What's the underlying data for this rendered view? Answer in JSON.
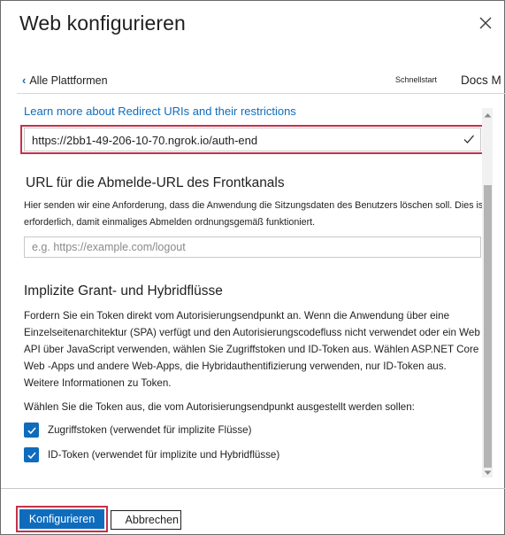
{
  "header": {
    "title": "Web konfigurieren",
    "close_icon": "close-icon"
  },
  "nav": {
    "back_label": "Alle Plattformen",
    "quickstart_label": "Schnellstart",
    "docs_label": "Docs M"
  },
  "redirect": {
    "learn_more": "Learn more about Redirect URIs and their restrictions",
    "url_value": "https://2bb1-49-206-10-70.ngrok.io/auth-end"
  },
  "logout": {
    "title": "URL für die Abmelde-URL des Frontkanals",
    "description": "Hier senden wir eine Anforderung, dass die Anwendung die Sitzungsdaten des Benutzers löschen soll. Dies ist erforderlich, damit einmaliges Abmelden ordnungsgemäß funktioniert.",
    "placeholder": "e.g. https://example.com/logout"
  },
  "implicit": {
    "title": "Implizite Grant- und Hybridflüsse",
    "description": "Fordern Sie ein Token direkt vom Autorisierungsendpunkt an. Wenn die Anwendung über eine Einzelseitenarchitektur (SPA) verfügt und den Autorisierungscodefluss nicht verwendet oder ein Web API über JavaScript verwenden, wählen Sie Zugriffstoken und ID-Token aus. Wählen ASP.NET Core Web -Apps und andere Web-Apps, die Hybridauthentifizierung verwenden, nur ID-Token aus. Weitere Informationen zu Token.",
    "token_prompt": "Wählen Sie die Token aus, die vom Autorisierungsendpunkt ausgestellt werden sollen:",
    "checkboxes": [
      {
        "label": "Zugriffstoken (verwendet für implizite Flüsse)",
        "checked": true
      },
      {
        "label": "ID-Token (verwendet für implizite und Hybridflüsse)",
        "checked": true
      }
    ]
  },
  "footer": {
    "configure_label": "Konfigurieren",
    "cancel_label": "Abbrechen"
  },
  "colors": {
    "accent": "#0f6cbd",
    "highlight": "#c4314b"
  }
}
